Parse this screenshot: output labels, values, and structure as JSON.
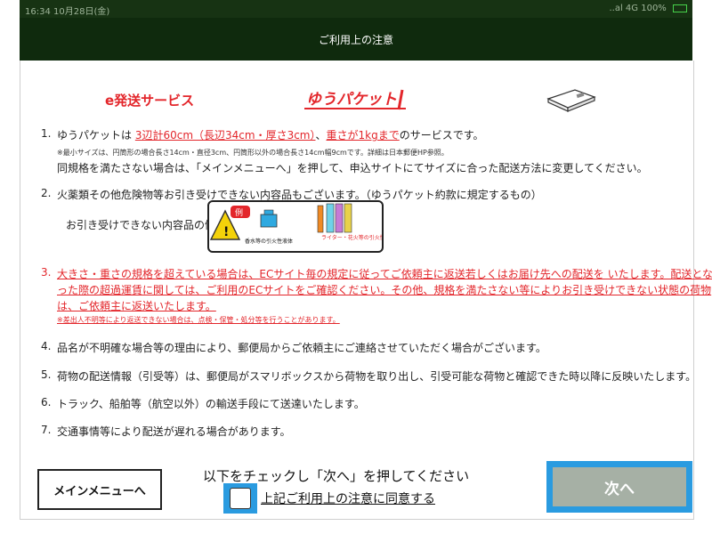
{
  "status": {
    "left": "16:34 10月28日(金)",
    "right": "..al 4G 100%"
  },
  "header": {
    "title": "ご利用上の注意"
  },
  "service_label": "e発送サービス",
  "logo_text": "ゆうパケット",
  "items": [
    {
      "num": "1.",
      "lines": [
        {
          "parts": [
            {
              "t": "ゆうパケットは "
            },
            {
              "t": "3辺計60cm（長辺34cm・厚さ3cm）",
              "cls": "red u"
            },
            {
              "t": "、"
            },
            {
              "t": "重さが1kgまで",
              "cls": "red u"
            },
            {
              "t": "のサービスです。"
            }
          ]
        },
        {
          "small": "※最小サイズは、円筒形の場合長さ14cm・直径3cm、円筒形以外の場合長さ14cm幅9cmです。詳細は日本郵便HP参照。"
        },
        {
          "text": "同規格を満たさない場合は、「メインメニューへ」を押して、申込サイトにてサイズに合った配送方法に変更してください。"
        }
      ]
    },
    {
      "num": "2.",
      "lines": [
        {
          "text": "火薬類その他危険物等お引き受けできない内容品もございます。（ゆうパケット約款に規定するもの）"
        }
      ],
      "excl_label": "お引き受けできない内容品の例",
      "excl_tag": "例",
      "excl_items": [
        "香水等の引火性液体",
        "ライター・花火等の引火性ガス、火薬類"
      ]
    },
    {
      "num": "3.",
      "red": true,
      "lines": [
        {
          "text": "大きさ・重さの規格を超えている場合は、ECサイト毎の規定に従ってご依頼主に返送若しくはお届け先への配送を いたします。配送とな"
        },
        {
          "text": "った際の超過運賃に関しては、ご利用のECサイトをご確認ください。その他、規格を満たさない等によりお引き受けできない状態の荷物"
        },
        {
          "text": "は、ご依頼主に返送いたします。"
        },
        {
          "small": "※差出人不明等により返送できない場合は、点検・保管・処分等を行うことがあります。"
        }
      ]
    },
    {
      "num": "4.",
      "lines": [
        {
          "text": "品名が不明確な場合等の理由により、郵便局からご依頼主にご連絡させていただく場合がございます。"
        }
      ]
    },
    {
      "num": "5.",
      "lines": [
        {
          "text": "荷物の配送情報（引受等）は、郵便局がスマリボックスから荷物を取り出し、引受可能な荷物と確認できた時以降に反映いたします。"
        }
      ]
    },
    {
      "num": "6.",
      "lines": [
        {
          "text": "トラック、船舶等（航空以外）の輸送手段にて送達いたします。"
        }
      ]
    },
    {
      "num": "7.",
      "lines": [
        {
          "text": "交通事情等により配送が遅れる場合があります。"
        }
      ]
    }
  ],
  "footer": {
    "menu_button": "メインメニューへ",
    "instruction": "以下をチェックし「次へ」を押してください",
    "agree_label": "上記ご利用上の注意に同意する",
    "next_button": "次へ"
  },
  "colors": {
    "header_bg": "#0f2a0d",
    "accent_red": "#e3262b",
    "highlight_blue": "#2a9be0",
    "next_bg": "#a6b0a5"
  }
}
